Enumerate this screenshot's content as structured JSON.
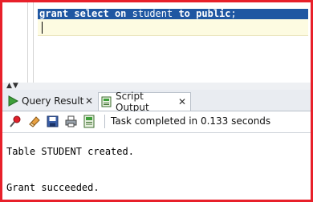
{
  "editor": {
    "statement": {
      "grant": "grant",
      "select": "select",
      "on": "on",
      "object": "student",
      "to": "to",
      "public": "public",
      "terminator": ";"
    }
  },
  "splitter": {
    "arrows_label": "▲▼"
  },
  "tabs": [
    {
      "label": "Query Result",
      "close": "✕",
      "icon": "green-play-icon",
      "active": false
    },
    {
      "label": "Script Output",
      "close": "✕",
      "icon": "script-output-icon",
      "active": true
    }
  ],
  "toolbar": {
    "icons": [
      "pin-icon",
      "eraser-icon",
      "save-icon",
      "print-icon",
      "script-icon"
    ],
    "status": "Task completed in 0.133 seconds"
  },
  "output": {
    "lines": [
      "Table STUDENT created.",
      "Grant succeeded."
    ]
  },
  "colors": {
    "frame_border": "#e8202a",
    "selection": "#1f57a2",
    "current_line": "#fdfbe1",
    "tab_bar": "#e9ecf1"
  }
}
